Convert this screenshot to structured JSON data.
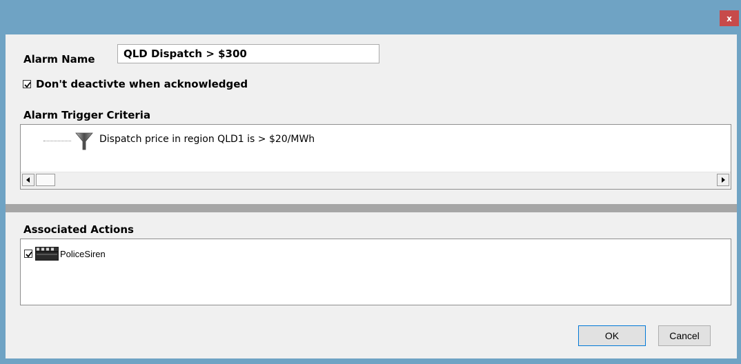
{
  "window": {
    "close_label": "x"
  },
  "form": {
    "alarm_name_label": "Alarm Name",
    "alarm_name_value": "QLD Dispatch > $300",
    "dont_deactivate_label": "Don't deactivte when acknowledged",
    "dont_deactivate_checked": true
  },
  "criteria": {
    "heading": "Alarm Trigger Criteria",
    "items": [
      {
        "icon": "funnel-icon",
        "text": "Dispatch price in region QLD1 is > $20/MWh"
      }
    ]
  },
  "actions": {
    "heading": "Associated Actions",
    "items": [
      {
        "icon": "clapperboard-icon",
        "label": "PoliceSiren",
        "checked": true
      }
    ]
  },
  "buttons": {
    "ok": "OK",
    "cancel": "Cancel"
  }
}
